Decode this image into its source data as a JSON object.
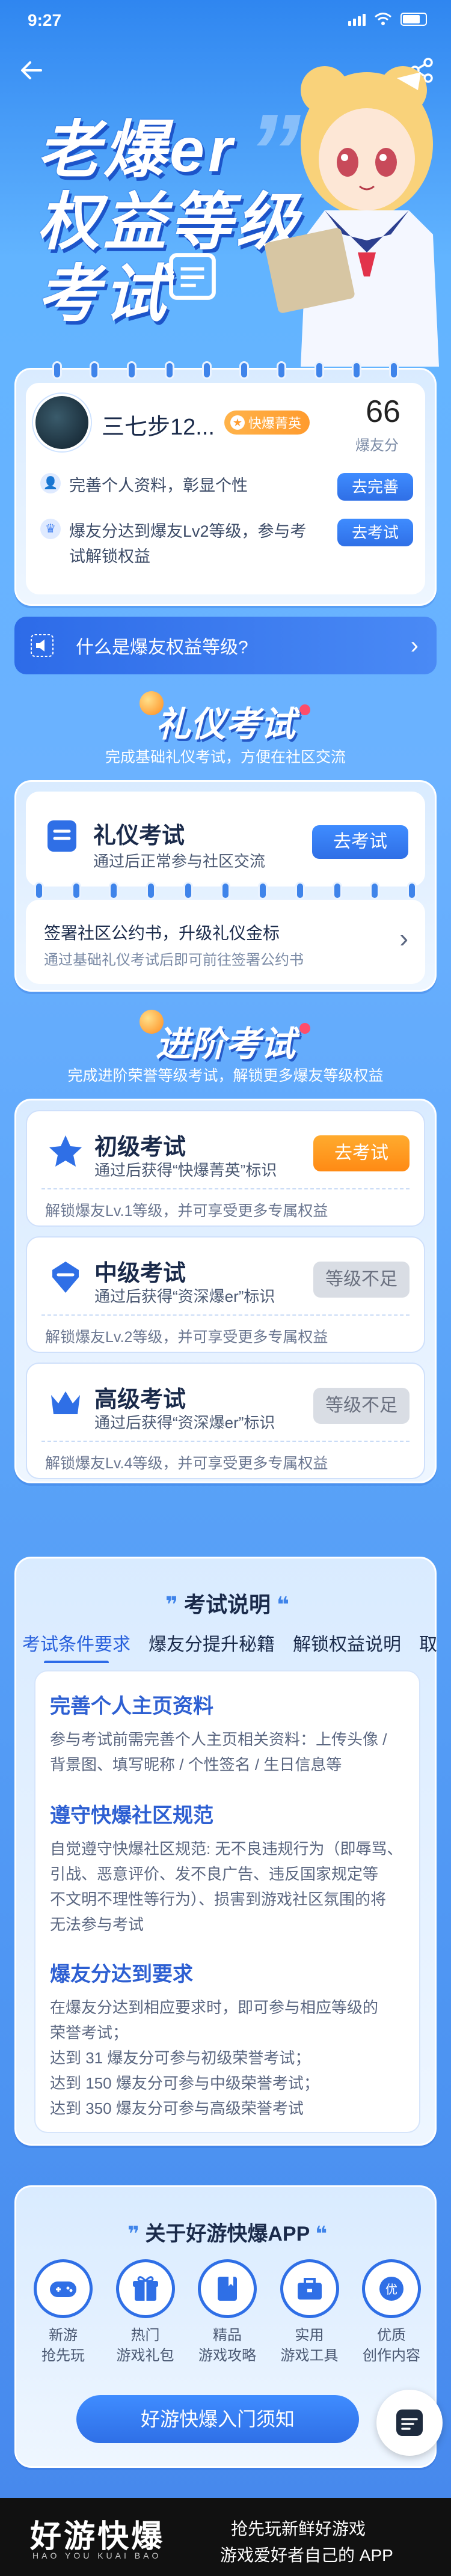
{
  "status_bar": {
    "time": "9:27"
  },
  "hero": {
    "line1": "老爆er",
    "line2": "权益等级",
    "line3": "考试",
    "quote": "”"
  },
  "profile": {
    "username": "三七步12...",
    "badge": "快爆菁英",
    "fan_count": "66",
    "fan_label": "爆友分",
    "tasks": [
      {
        "icon": "person-icon",
        "text": "完善个人资料，彰显个性",
        "button": "去完善"
      },
      {
        "icon": "crown-icon",
        "text": "爆友分达到爆友Lv2等级，参与考试解锁权益",
        "button": "去考试"
      }
    ]
  },
  "what_bar": {
    "label": "什么是爆友权益等级?",
    "arrow": "›"
  },
  "etiquette": {
    "title": "礼仪考试",
    "subtitle": "完成基础礼仪考试，方便在社区交流",
    "exam": {
      "name": "礼仪考试",
      "desc": "通过后正常参与社区交流",
      "button": "去考试"
    },
    "covenant": {
      "title": "签署社区公约书，升级礼仪金标",
      "desc": "通过基础礼仪考试后即可前往签署公约书",
      "arrow": "›"
    }
  },
  "advanced": {
    "title": "进阶考试",
    "subtitle": "完成进阶荣誉等级考试，解锁更多爆友等级权益",
    "exams": [
      {
        "name": "初级考试",
        "desc": "通过后获得“快爆菁英”标识",
        "button": "去考试",
        "foot": "解锁爆友Lv.1等级，并可享受更多专属权益",
        "state": "active",
        "color": "#2f6fe6"
      },
      {
        "name": "中级考试",
        "desc": "通过后获得“资深爆er”标识",
        "button": "等级不足",
        "foot": "解锁爆友Lv.2等级，并可享受更多专属权益",
        "state": "locked",
        "color": "#2f6fe6"
      },
      {
        "name": "高级考试",
        "desc": "通过后获得“资深爆er”标识",
        "button": "等级不足",
        "foot": "解锁爆友Lv.4等级，并可享受更多专属权益",
        "state": "locked",
        "color": "#2f6fe6"
      }
    ]
  },
  "description": {
    "title": "考试说明",
    "tabs": [
      "考试条件要求",
      "爆友分提升秘籍",
      "解锁权益说明",
      "取消"
    ],
    "sections": [
      {
        "title": "完善个人主页资料",
        "lines": [
          "参与考试前需完善个人主页相关资料：上传头像 /",
          "背景图、填写昵称 / 个性签名 / 生日信息等"
        ]
      },
      {
        "title": "遵守快爆社区规范",
        "lines": [
          "自觉遵守快爆社区规范: 无不良违规行为（即辱骂、",
          "引战、恶意评价、发不良广告、违反国家规定等",
          "不文明不理性等行为）、损害到游戏社区氛围的将",
          "无法参与考试"
        ]
      },
      {
        "title": "爆友分达到要求",
        "lines": [
          "在爆友分达到相应要求时，即可参与相应等级的",
          "荣誉考试；",
          "达到 31 爆友分可参与初级荣誉考试；",
          "达到 150 爆友分可参与中级荣誉考试；",
          "达到 350 爆友分可参与高级荣誉考试"
        ]
      }
    ]
  },
  "about": {
    "title": "关于好游快爆APP",
    "features": [
      {
        "icon": "gamepad-icon",
        "l1": "新游",
        "l2": "抢先玩"
      },
      {
        "icon": "gift-icon",
        "l1": "热门",
        "l2": "游戏礼包"
      },
      {
        "icon": "book-icon",
        "l1": "精品",
        "l2": "游戏攻略"
      },
      {
        "icon": "toolbox-icon",
        "l1": "实用",
        "l2": "游戏工具"
      },
      {
        "icon": "coin-icon",
        "l1": "优质",
        "l2": "创作内容"
      }
    ],
    "button": "好游快爆入门须知",
    "coin_glyph": "优"
  },
  "footer": {
    "brand": "好游快爆",
    "brand_en": "HAO YOU KUAI BAO",
    "slogan1": "抢先玩新鲜好游戏",
    "slogan2": "游戏爱好者自己的 APP"
  },
  "colors": {
    "primary": "#2f6fe6",
    "orange": "#ff8a14",
    "background": "#62b4ff"
  }
}
